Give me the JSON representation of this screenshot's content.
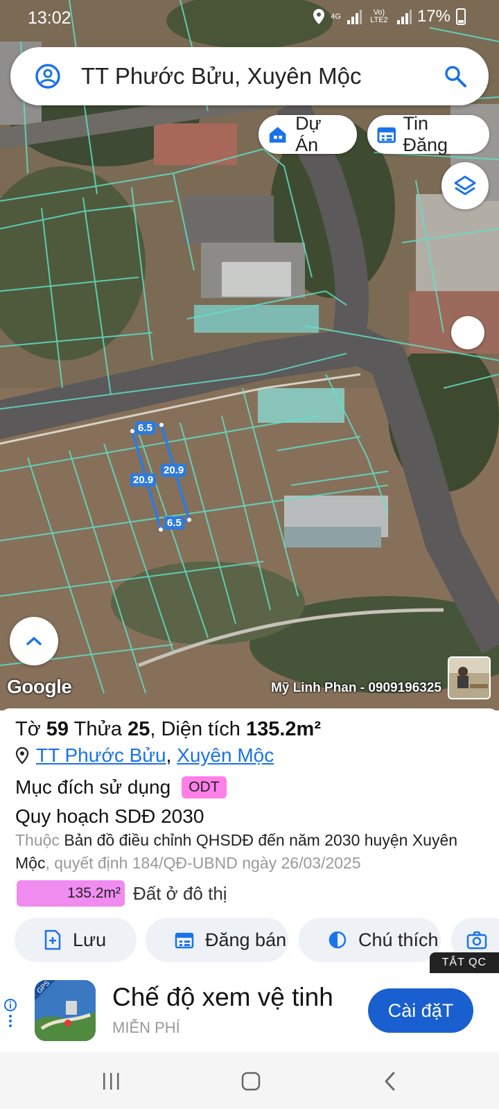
{
  "status_bar": {
    "time": "13:02",
    "network_4g": "4G",
    "network_volte": "Vo) LTE2",
    "battery": "17%"
  },
  "search": {
    "query": "TT Phước Bửu, Xuyên Mộc",
    "profile_icon": "account-circle-icon",
    "search_icon": "search-icon"
  },
  "chips": {
    "du_an": "Dự Án",
    "tin_dang": "Tin Đăng"
  },
  "map": {
    "google_logo": "Google",
    "credit": "Mỹ Linh Phan - 0909196325",
    "dimensions": {
      "top": "6.5",
      "bottom": "6.5",
      "left": "20.9",
      "right": "20.9"
    },
    "parcel_color": "#2f7bdb",
    "boundary_color": "#5fe0c8"
  },
  "parcel": {
    "label_to": "Tờ",
    "to_number": "59",
    "label_thua": "Thửa",
    "thua_number": "25",
    "label_area": "Diện tích",
    "area": "135.2m²",
    "location_town": "TT Phước Bửu",
    "location_separator": ",",
    "location_district": "Xuyên Mộc",
    "purpose_label": "Mục đích sử dụng",
    "purpose_code": "ODT",
    "plan_title": "Quy hoạch SDĐ 2030",
    "plan_prefix": "Thuộc",
    "plan_name": "Bản đồ điều chỉnh QHSDĐ đến năm 2030 huyện Xuyên Mộc",
    "plan_decision": ", quyết định 184/QĐ-UBND ngày 26/03/2025",
    "area_value": "135.2m²",
    "area_type": "Đất ở đô thị"
  },
  "actions": {
    "save": "Lưu",
    "post_sale": "Đăng bán",
    "legend": "Chú thích",
    "camera": "C"
  },
  "ad": {
    "close_label": "TẮT QC",
    "title": "Chế độ xem vệ tinh",
    "subtitle": "MIỄN PHÍ",
    "cta": "Cài đặT",
    "icon_badge": "GPS"
  },
  "colors": {
    "accent": "#1a73e8",
    "odt_badge": "#ff7fe8",
    "area_bar": "#f08cf0",
    "ad_cta": "#1a5fd0"
  }
}
